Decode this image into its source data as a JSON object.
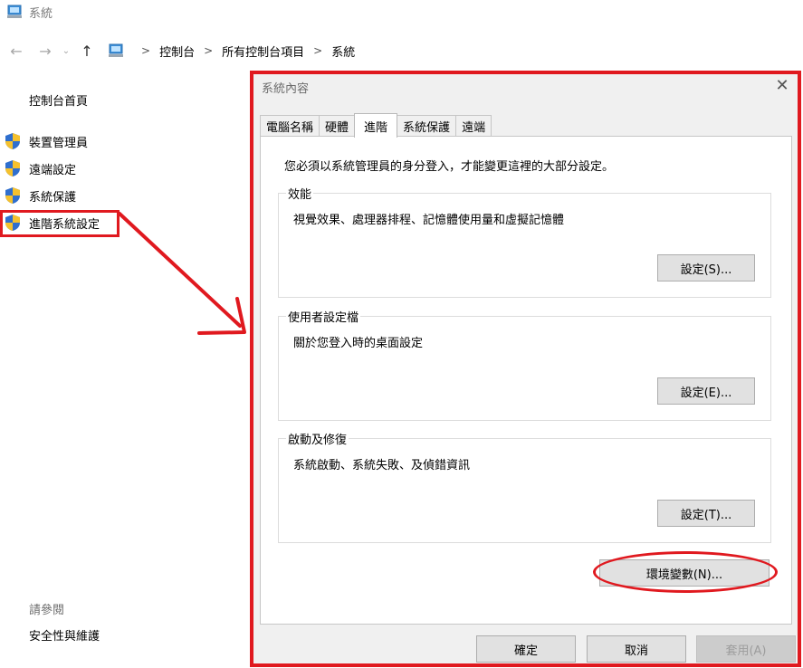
{
  "window": {
    "title": "系統"
  },
  "address_bar": {
    "crumbs": [
      "控制台",
      "所有控制台項目",
      "系統"
    ],
    "separator": ">"
  },
  "left_panel": {
    "home": "控制台首頁",
    "items": [
      {
        "label": "裝置管理員"
      },
      {
        "label": "遠端設定"
      },
      {
        "label": "系統保護"
      },
      {
        "label": "進階系統設定"
      }
    ],
    "see_also": "請參閱",
    "security_link": "安全性與維護"
  },
  "dialog": {
    "title": "系統內容",
    "close_glyph": "✕",
    "tabs": [
      {
        "label": "電腦名稱",
        "active": false
      },
      {
        "label": "硬體",
        "active": false
      },
      {
        "label": "進階",
        "active": true
      },
      {
        "label": "系統保護",
        "active": false
      },
      {
        "label": "遠端",
        "active": false
      }
    ],
    "admin_note": "您必須以系統管理員的身分登入，才能變更這裡的大部分設定。",
    "groups": [
      {
        "legend": "效能",
        "desc": "視覺效果、處理器排程、記憶體使用量和虛擬記憶體",
        "button": "設定(S)..."
      },
      {
        "legend": "使用者設定檔",
        "desc": "關於您登入時的桌面設定",
        "button": "設定(E)..."
      },
      {
        "legend": "啟動及修復",
        "desc": "系統啟動、系統失敗、及偵錯資訊",
        "button": "設定(T)..."
      }
    ],
    "env_button": "環境變數(N)...",
    "ok_button": "確定",
    "cancel_button": "取消",
    "apply_button": "套用(A)"
  },
  "annotation_color": "#e0191f"
}
